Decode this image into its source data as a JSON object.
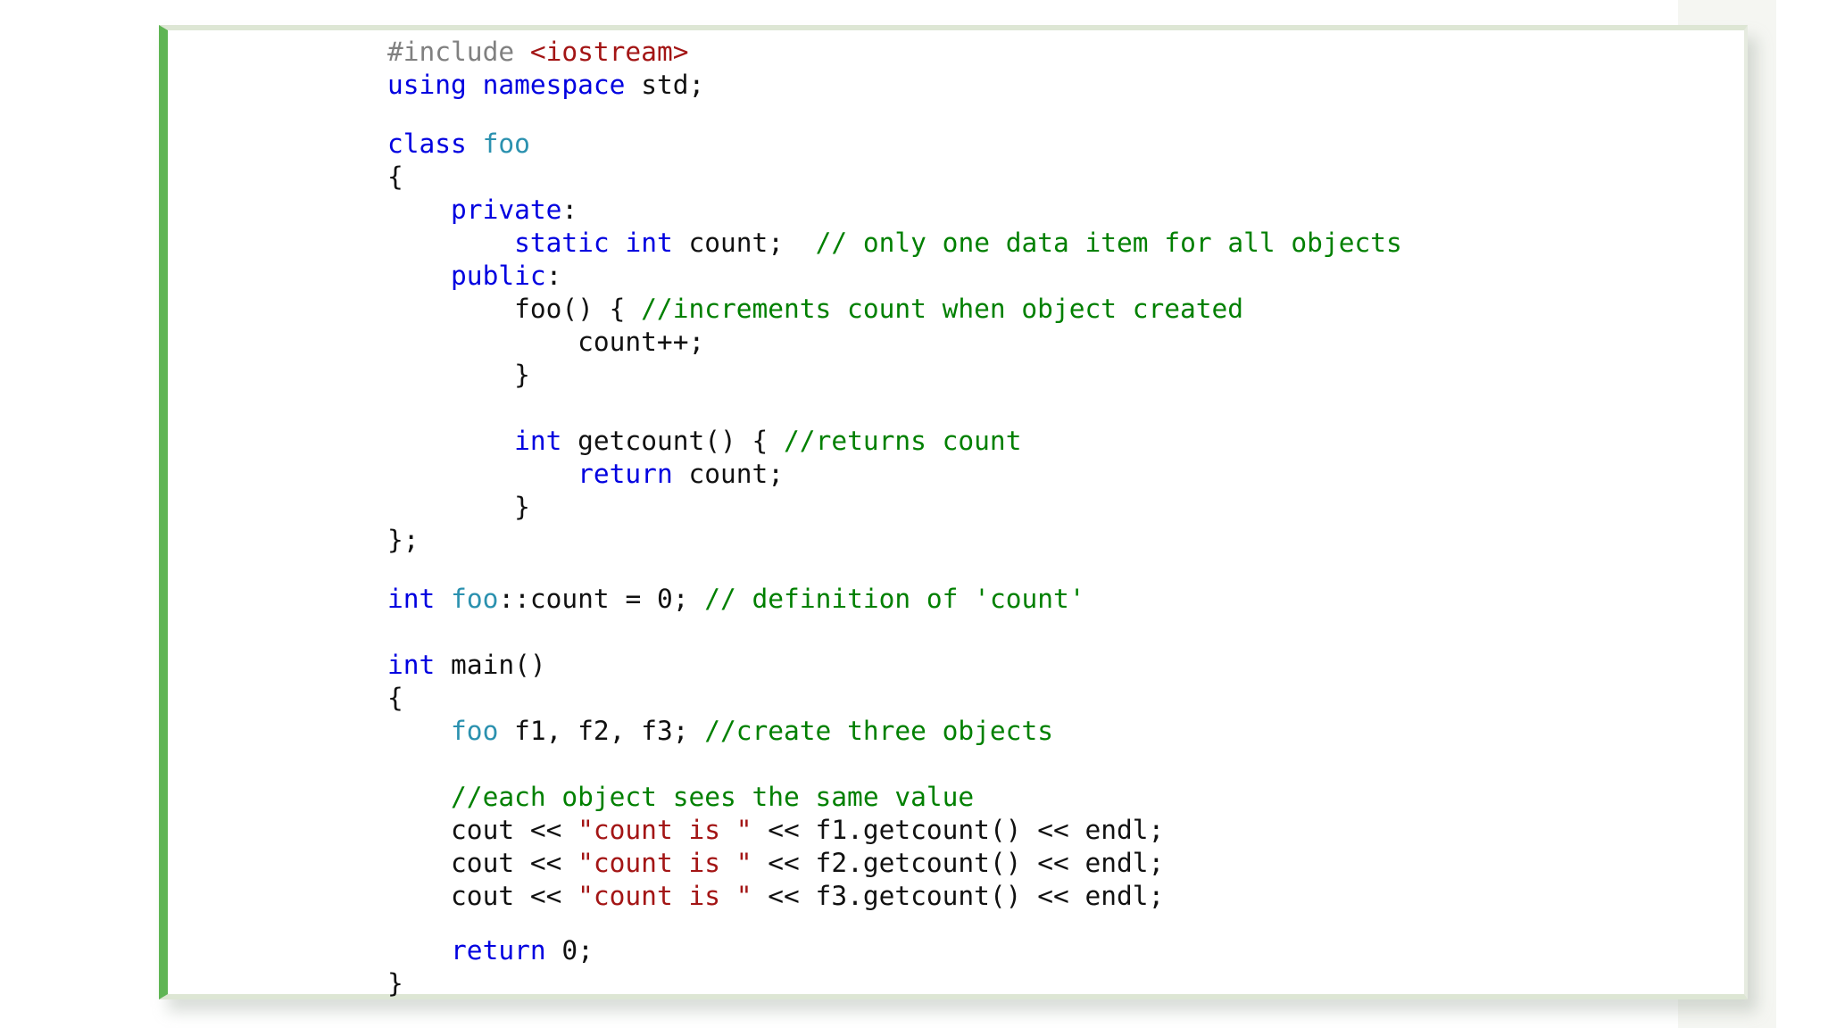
{
  "code": {
    "language": "C++",
    "lines": [
      {
        "tokens": [
          {
            "t": "#include ",
            "c": "pp"
          },
          {
            "t": "<iostream>",
            "c": "str"
          }
        ]
      },
      {
        "tokens": [
          {
            "t": "using",
            "c": "kw"
          },
          {
            "t": " "
          },
          {
            "t": "namespace",
            "c": "kw"
          },
          {
            "t": " std;"
          }
        ]
      },
      {
        "tokens": [
          {
            "t": "class",
            "c": "kw"
          },
          {
            "t": " "
          },
          {
            "t": "foo",
            "c": "ty"
          }
        ]
      },
      {
        "tokens": [
          {
            "t": "{"
          }
        ]
      },
      {
        "tokens": [
          {
            "t": "    "
          },
          {
            "t": "private",
            "c": "kw"
          },
          {
            "t": ":"
          }
        ]
      },
      {
        "tokens": [
          {
            "t": "        "
          },
          {
            "t": "static",
            "c": "kw"
          },
          {
            "t": " "
          },
          {
            "t": "int",
            "c": "kw"
          },
          {
            "t": " count;  "
          },
          {
            "t": "// only one data item for all objects",
            "c": "cm"
          }
        ]
      },
      {
        "tokens": [
          {
            "t": "    "
          },
          {
            "t": "public",
            "c": "kw"
          },
          {
            "t": ":"
          }
        ]
      },
      {
        "tokens": [
          {
            "t": "        foo() { "
          },
          {
            "t": "//increments count when object created",
            "c": "cm"
          }
        ]
      },
      {
        "tokens": [
          {
            "t": "            count++;"
          }
        ]
      },
      {
        "tokens": [
          {
            "t": "        }"
          }
        ]
      },
      {
        "tokens": [
          {
            "t": "        "
          },
          {
            "t": "int",
            "c": "kw"
          },
          {
            "t": " getcount() { "
          },
          {
            "t": "//returns count",
            "c": "cm"
          }
        ]
      },
      {
        "tokens": [
          {
            "t": "            "
          },
          {
            "t": "return",
            "c": "kw"
          },
          {
            "t": " count;"
          }
        ]
      },
      {
        "tokens": [
          {
            "t": "        }"
          }
        ]
      },
      {
        "tokens": [
          {
            "t": "};"
          }
        ]
      },
      {
        "tokens": [
          {
            "t": "int",
            "c": "kw"
          },
          {
            "t": " "
          },
          {
            "t": "foo",
            "c": "ty"
          },
          {
            "t": "::count = 0; "
          },
          {
            "t": "// definition of 'count'",
            "c": "cm"
          }
        ]
      },
      {
        "tokens": [
          {
            "t": "int",
            "c": "kw"
          },
          {
            "t": " main()"
          }
        ]
      },
      {
        "tokens": [
          {
            "t": "{"
          }
        ]
      },
      {
        "tokens": [
          {
            "t": "    "
          },
          {
            "t": "foo",
            "c": "ty"
          },
          {
            "t": " f1, f2, f3; "
          },
          {
            "t": "//create three objects",
            "c": "cm"
          }
        ]
      },
      {
        "tokens": [
          {
            "t": "    "
          },
          {
            "t": "//each object sees the same value",
            "c": "cm"
          }
        ]
      },
      {
        "tokens": [
          {
            "t": "    cout << "
          },
          {
            "t": "\"count is \"",
            "c": "str"
          },
          {
            "t": " << f1.getcount() << endl;"
          }
        ]
      },
      {
        "tokens": [
          {
            "t": "    cout << "
          },
          {
            "t": "\"count is \"",
            "c": "str"
          },
          {
            "t": " << f2.getcount() << endl;"
          }
        ]
      },
      {
        "tokens": [
          {
            "t": "    cout << "
          },
          {
            "t": "\"count is \"",
            "c": "str"
          },
          {
            "t": " << f3.getcount() << endl;"
          }
        ]
      },
      {
        "tokens": [
          {
            "t": "    "
          },
          {
            "t": "return",
            "c": "kw"
          },
          {
            "t": " 0;"
          }
        ]
      },
      {
        "tokens": [
          {
            "t": "}"
          }
        ]
      }
    ]
  },
  "colors": {
    "accent_border": "#5fb554",
    "keyword": "#0000e0",
    "type": "#2b91af",
    "string": "#a31515",
    "comment": "#008000",
    "preprocessor": "#808080",
    "text": "#111111"
  }
}
